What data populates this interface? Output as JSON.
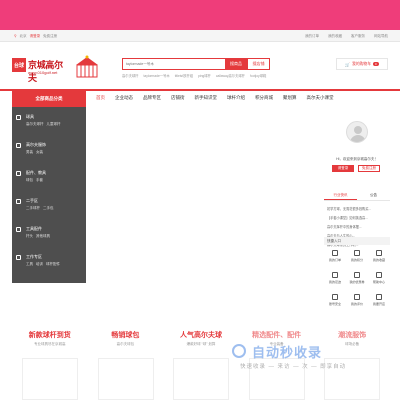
{
  "topbar": {
    "location": "北京",
    "login": "请登录",
    "register": "免费注册",
    "links": [
      "我的订单",
      "我的收藏",
      "客户服务",
      "网站导航"
    ]
  },
  "logo": {
    "icon_text": "台球",
    "name": "京城高尔夫",
    "domain": "www.010golf.net"
  },
  "search": {
    "placeholder": "taylormade一号木",
    "button_site": "搜商品",
    "button_store": "搜店铺",
    "hotwords": [
      "高尔夫球杆",
      "taylormade一号木",
      "titleist铁杆组",
      "ping球杆",
      "callaway高尔夫球杆",
      "footjoy球鞋"
    ]
  },
  "cart": {
    "label": "我的购物车",
    "count": "0"
  },
  "nav": {
    "category_header": "全部商品分类",
    "items": [
      "首页",
      "企业动态",
      "品牌专区",
      "店铺街",
      "新手知识堂",
      "球杆介绍",
      "积分商城",
      "聚划算",
      "高尔夫小课堂"
    ]
  },
  "categories": [
    {
      "title": "球具",
      "subs": [
        "高尔夫球杆",
        "儿童球杆"
      ]
    },
    {
      "title": "高尔夫服饰",
      "subs": [
        "男装",
        "女装"
      ]
    },
    {
      "title": "配件、教具",
      "subs": [
        "球包",
        "手套"
      ]
    },
    {
      "title": "二手区",
      "subs": [
        "二手球杆",
        "二手包"
      ]
    },
    {
      "title": "工具配件",
      "subs": [
        "杆头",
        "其他球具"
      ]
    },
    {
      "title": "工作专区",
      "subs": [
        "工具",
        "培训",
        "球杆配件"
      ]
    }
  ],
  "user": {
    "welcome": "Hi，欢迎来到京城高尔夫！",
    "login": "请登录",
    "register": "免费注册"
  },
  "news": {
    "tabs": [
      "行业快讯",
      "公告"
    ],
    "items": [
      "初学打球，无需花很多钱购买...",
      "【手套小课堂】如何挑选高...",
      "高尔夫挥杆中的身体摆...",
      "高尔夫与人生的心...",
      "高尔夫球童的工作职..."
    ]
  },
  "quick": {
    "title": "快捷入口",
    "items": [
      "我的订单",
      "我的积分",
      "我的收藏",
      "我的足迹",
      "我的优惠券",
      "帮助中心",
      "账号安全",
      "我的评价",
      "我要开店"
    ]
  },
  "promos": [
    {
      "title": "新款球杆到货",
      "sub": "专业球具尽在京城高"
    },
    {
      "title": "畅销球包",
      "sub": "高尔夫球包"
    },
    {
      "title": "人气高尔夫球",
      "sub": "爆款好球 “球” 划算"
    },
    {
      "title": "精选配件、配件",
      "sub": "专业装备"
    },
    {
      "title": "潮流服饰",
      "sub": "球场必备"
    }
  ],
  "watermark": {
    "title": "自动秒收录",
    "sub": "快速收录 — 来访 — 次 — 即享自动"
  }
}
